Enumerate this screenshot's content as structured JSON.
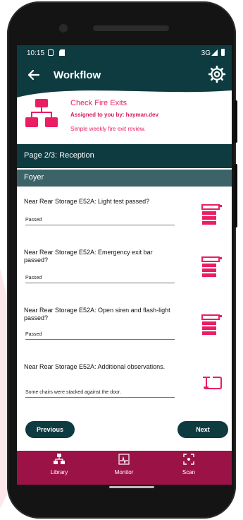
{
  "status_bar": {
    "time": "10:15",
    "network": "3G"
  },
  "app_bar": {
    "title": "Workflow",
    "back_icon": "back-arrow-icon",
    "settings_icon": "settings-icon"
  },
  "form": {
    "title": "Check Fire Exits",
    "assigned": "Assigned to you by: hayman.dev",
    "description": "Simple weekly fire exit review."
  },
  "page": {
    "label": "Page 2/3: Reception",
    "section": "Foyer"
  },
  "questions": [
    {
      "text": "Near Rear Storage E52A: Light test passed?",
      "answer": "Passed",
      "icon": "dropdown-list-icon"
    },
    {
      "text": "Near Rear Storage E52A: Emergency exit bar passed?",
      "answer": "Passed",
      "icon": "dropdown-list-icon"
    },
    {
      "text": "Near Rear Storage E52A: Open siren and flash-light passed?",
      "answer": "Passed",
      "icon": "dropdown-list-icon"
    },
    {
      "text": "Near Rear Storage E52A: Additional observations.",
      "answer": "Some chairs were stacked against the door.",
      "icon": "text-field-icon"
    }
  ],
  "buttons": {
    "previous": "Previous",
    "next": "Next"
  },
  "bottom_nav": [
    {
      "label": "Library",
      "icon": "library-icon"
    },
    {
      "label": "Monitor",
      "icon": "monitor-icon"
    },
    {
      "label": "Scan",
      "icon": "scan-icon"
    }
  ],
  "colors": {
    "primary": "#0d3b40",
    "accent": "#e91e63",
    "nav": "#9b1346"
  }
}
